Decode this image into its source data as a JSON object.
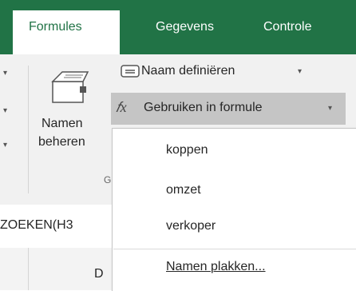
{
  "tabs": [
    {
      "label": "Formules",
      "active": true
    },
    {
      "label": "Gegevens",
      "active": false
    },
    {
      "label": "Controle",
      "active": false
    }
  ],
  "ribbon": {
    "names_button_line1": "Namen",
    "names_button_line2": "beheren",
    "define_name_label": "Naam definiëren",
    "use_in_formula_label": "Gebruiken in formule",
    "group_label_partial": "G"
  },
  "dropdown": {
    "items": [
      "koppen",
      "omzet",
      "verkoper"
    ],
    "paste_names_label": "Namen plakken..."
  },
  "formula_bar": {
    "partial_text": "ZOEKEN(H3"
  },
  "column_header": {
    "partial_label": "D"
  },
  "colors": {
    "accent": "#217346",
    "hover": "#c5c5c5",
    "ribbon_bg": "#f1f1f1"
  }
}
